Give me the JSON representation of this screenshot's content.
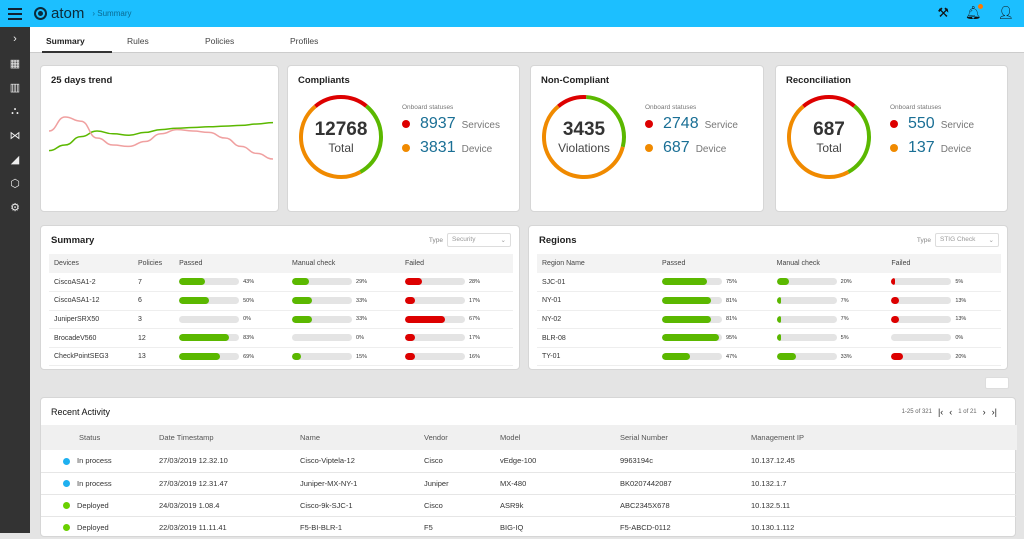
{
  "app": {
    "name": "atom",
    "breadcrumb": "Summary",
    "menu_icon": "hamburger-icon",
    "icons": [
      "gavel-icon",
      "bell-icon",
      "user-icon"
    ],
    "notification_color": "#ff7a00"
  },
  "sidebar": {
    "items": [
      {
        "icon": "chevron-right-icon",
        "glyph": "›"
      },
      {
        "icon": "dashboard-icon",
        "glyph": "▦"
      },
      {
        "icon": "chart-icon",
        "glyph": "▥"
      },
      {
        "icon": "topology-icon",
        "glyph": "⛬"
      },
      {
        "icon": "network-icon",
        "glyph": "⋈"
      },
      {
        "icon": "tag-icon",
        "glyph": "◢"
      },
      {
        "icon": "cube-icon",
        "glyph": "⬡"
      },
      {
        "icon": "settings-icon",
        "glyph": "⚙"
      }
    ]
  },
  "tabs": [
    {
      "label": "Summary",
      "active": true
    },
    {
      "label": "Rules"
    },
    {
      "label": "Policies"
    },
    {
      "label": "Profiles"
    }
  ],
  "trend": {
    "title": "25 days trend",
    "chart_data": {
      "type": "line",
      "series": [
        {
          "color": "#5bb800",
          "values": [
            22,
            30,
            42,
            50,
            46,
            44,
            48,
            52,
            54,
            55,
            56,
            57,
            58,
            60,
            62
          ]
        },
        {
          "color": "#f0a0a0",
          "values": [
            50,
            70,
            64,
            40,
            30,
            28,
            35,
            46,
            52,
            50,
            48,
            40,
            28,
            18,
            10
          ]
        }
      ]
    }
  },
  "donuts": [
    {
      "title": "Compliants",
      "center_value": "12768",
      "center_label": "Total",
      "legend_title": "Onboard statuses",
      "items": [
        {
          "value": "8937",
          "label": "Services",
          "color": "#dd0000"
        },
        {
          "value": "3831",
          "label": "Device",
          "color": "#f08a00"
        }
      ],
      "segments": [
        {
          "color": "#dd0000",
          "fraction": 0.22
        },
        {
          "color": "#5bb800",
          "fraction": 0.31
        },
        {
          "color": "#f08a00",
          "fraction": 0.47
        }
      ]
    },
    {
      "title": "Non-Compliant",
      "center_value": "3435",
      "center_label": "Violations",
      "legend_title": "Onboard statuses",
      "items": [
        {
          "value": "2748",
          "label": "Service",
          "color": "#dd0000"
        },
        {
          "value": "687",
          "label": "Device",
          "color": "#f08a00"
        }
      ],
      "segments": [
        {
          "color": "#dd0000",
          "fraction": 0.12
        },
        {
          "color": "#5bb800",
          "fraction": 0.28
        },
        {
          "color": "#f08a00",
          "fraction": 0.6
        }
      ]
    },
    {
      "title": "Reconciliation",
      "center_value": "687",
      "center_label": "Total",
      "legend_title": "Onboard statuses",
      "items": [
        {
          "value": "550",
          "label": "Service",
          "color": "#dd0000"
        },
        {
          "value": "137",
          "label": "Device",
          "color": "#f08a00"
        }
      ],
      "segments": [
        {
          "color": "#dd0000",
          "fraction": 0.22
        },
        {
          "color": "#5bb800",
          "fraction": 0.31
        },
        {
          "color": "#f08a00",
          "fraction": 0.47
        }
      ]
    }
  ],
  "summary": {
    "title": "Summary",
    "type_label": "Type",
    "type_value": "Security",
    "columns": [
      "Devices",
      "Policies",
      "Passed",
      "Manual check",
      "Failed"
    ],
    "rows": [
      [
        "CiscoASA1-2",
        "7",
        43,
        29,
        28
      ],
      [
        "CiscoASA1-12",
        "6",
        50,
        33,
        17
      ],
      [
        "JuniperSRX50",
        "3",
        0,
        33,
        67
      ],
      [
        "BrocadeV560",
        "12",
        83,
        0,
        17
      ],
      [
        "CheckPointSEG3",
        "13",
        69,
        15,
        16
      ]
    ]
  },
  "regions": {
    "title": "Regions",
    "type_label": "Type",
    "type_value": "STIG Check",
    "columns": [
      "Region Name",
      "Passed",
      "Manual check",
      "Failed"
    ],
    "rows": [
      [
        "SJC-01",
        75,
        20,
        5
      ],
      [
        "NY-01",
        81,
        7,
        13
      ],
      [
        "NY-02",
        81,
        7,
        13
      ],
      [
        "BLR-08",
        95,
        5,
        0
      ],
      [
        "TY-01",
        47,
        33,
        20
      ]
    ]
  },
  "colors": {
    "passed": "#5bb800",
    "manual": "#5bb800",
    "failed": "#dd0000",
    "in_process": "#1eb0f0",
    "deployed": "#6ad000"
  },
  "recent": {
    "title": "Recent Activity",
    "range": "1-25 of 321",
    "page": "1 of 21",
    "columns": [
      "Status",
      "Date Timestamp",
      "Name",
      "Vendor",
      "Model",
      "Serial Number",
      "Management IP"
    ],
    "rows": [
      {
        "status": "In process",
        "date": "27/03/2019 12.32.10",
        "name": "Cisco-Viptela-12",
        "vendor": "Cisco",
        "model": "vEdge-100",
        "serial": "9963194c",
        "ip": "10.137.12.45"
      },
      {
        "status": "In process",
        "date": "27/03/2019 12.31.47",
        "name": "Juniper-MX-NY-1",
        "vendor": "Juniper",
        "model": "MX-480",
        "serial": "BK0207442087",
        "ip": "10.132.1.7"
      },
      {
        "status": "Deployed",
        "date": "24/03/2019 1.08.4",
        "name": "Cisco-9k-SJC-1",
        "vendor": "Cisco",
        "model": "ASR9k",
        "serial": "ABC2345X678",
        "ip": "10.132.5.11"
      },
      {
        "status": "Deployed",
        "date": "22/03/2019 11.11.41",
        "name": "F5-BI-BLR-1",
        "vendor": "F5",
        "model": "BIG-IQ",
        "serial": "F5-ABCD-0112",
        "ip": "10.130.1.112"
      }
    ]
  }
}
